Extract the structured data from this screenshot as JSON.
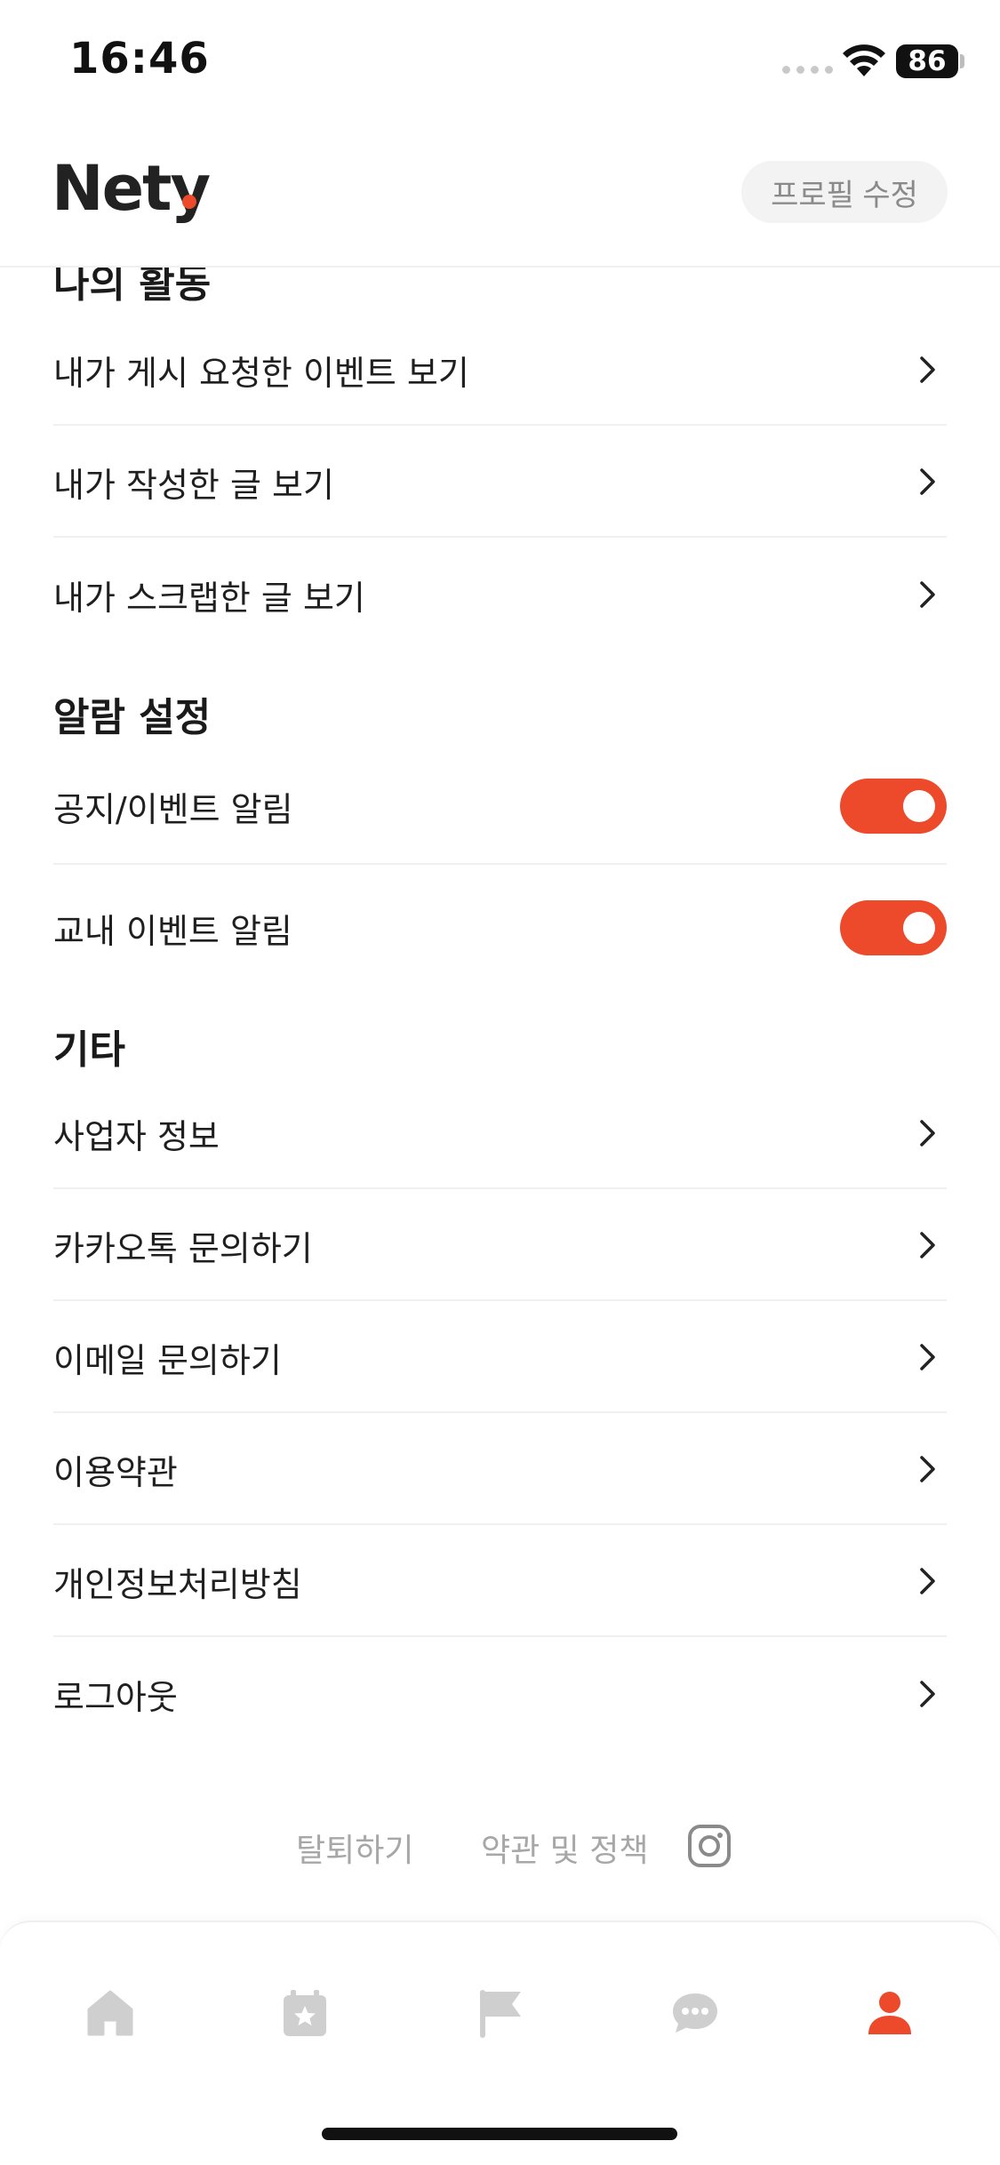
{
  "status_bar": {
    "time": "16:46",
    "battery": "86"
  },
  "header": {
    "logo": "Nety",
    "edit_profile_label": "프로필 수정"
  },
  "sections": {
    "activity": {
      "title": "나의 활동",
      "items": [
        {
          "label": "내가 게시 요청한 이벤트 보기"
        },
        {
          "label": "내가 작성한 글 보기"
        },
        {
          "label": "내가 스크랩한 글 보기"
        }
      ]
    },
    "notifications": {
      "title": "알람 설정",
      "items": [
        {
          "label": "공지/이벤트 알림",
          "enabled": true
        },
        {
          "label": "교내 이벤트 알림",
          "enabled": true
        }
      ]
    },
    "etc": {
      "title": "기타",
      "items": [
        {
          "label": "사업자 정보"
        },
        {
          "label": "카카오톡 문의하기"
        },
        {
          "label": "이메일 문의하기"
        },
        {
          "label": "이용약관"
        },
        {
          "label": "개인정보처리방침"
        },
        {
          "label": "로그아웃"
        }
      ]
    }
  },
  "footer": {
    "withdraw_label": "탈퇴하기",
    "terms_label": "약관 및 정책",
    "instagram_icon": "instagram-icon"
  },
  "tab_bar": {
    "items": [
      {
        "icon": "home-icon",
        "active": false
      },
      {
        "icon": "calendar-star-icon",
        "active": false
      },
      {
        "icon": "flag-icon",
        "active": false
      },
      {
        "icon": "chat-bubble-icon",
        "active": false
      },
      {
        "icon": "person-icon",
        "active": true
      }
    ]
  },
  "colors": {
    "accent": "#ec4a2a",
    "inactive_icon": "#cfcfcf",
    "muted_text": "#a7a7a7",
    "divider": "#f0f0f0"
  }
}
